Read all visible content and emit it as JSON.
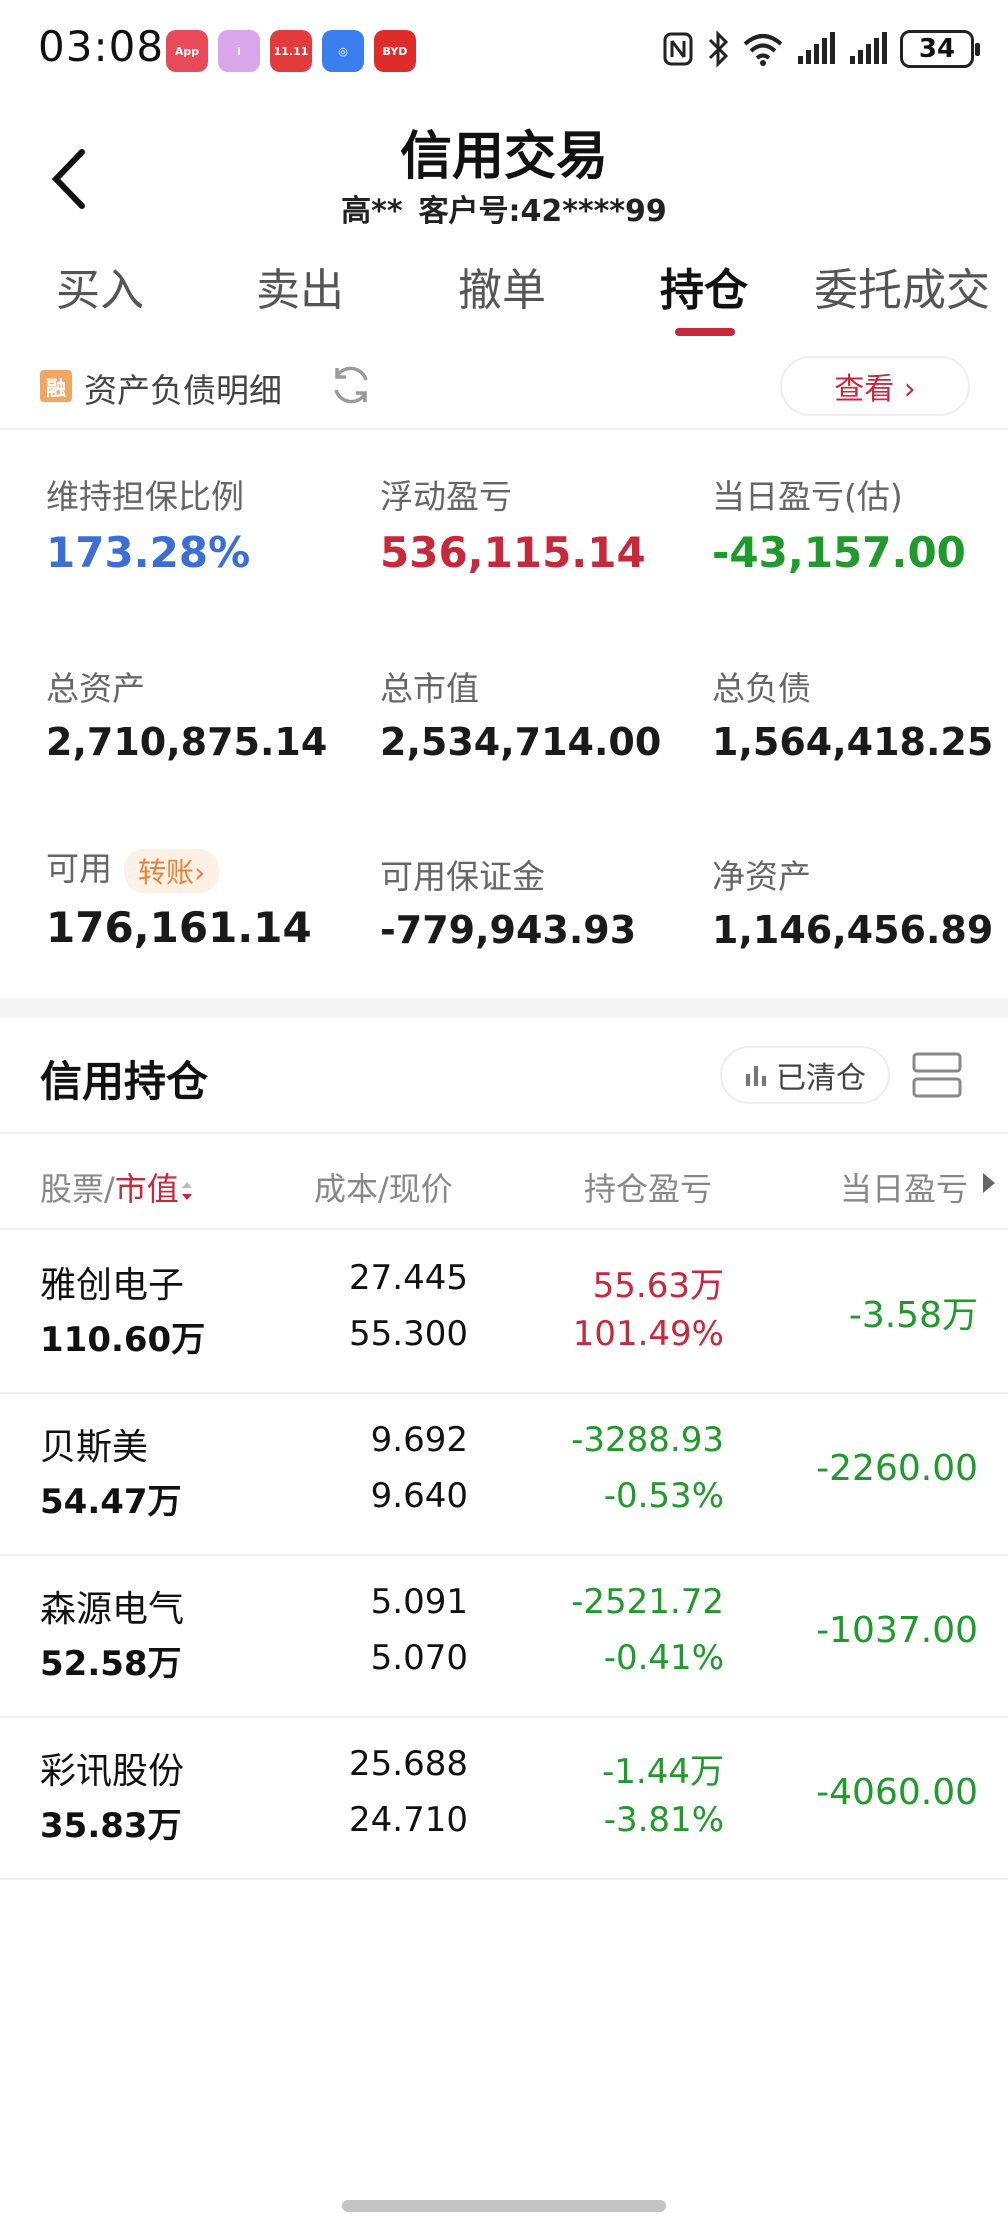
{
  "status": {
    "time": "03:08",
    "battery": "34",
    "app_icons": [
      {
        "name": "app-gallery-icon",
        "color": "#e84a5a",
        "text": "App"
      },
      {
        "name": "app-i-icon",
        "color": "#d8a0e8",
        "text": "i"
      },
      {
        "name": "app-1111-icon",
        "color": "#e33b3b",
        "text": "11.11"
      },
      {
        "name": "app-shield-icon",
        "color": "#3b7ef0",
        "text": "◎"
      },
      {
        "name": "app-byd-icon",
        "color": "#e02b2b",
        "text": "BYD"
      }
    ]
  },
  "header": {
    "title": "信用交易",
    "user_name": "高**",
    "account": "客户号:42****99"
  },
  "tabs": [
    "买入",
    "卖出",
    "撤单",
    "持仓",
    "委托成交"
  ],
  "active_tab": "持仓",
  "asset_bar": {
    "badge": "融",
    "label": "资产负债明细",
    "view_button": "查看 ›"
  },
  "summary": {
    "maintain_ratio": {
      "label": "维持担保比例",
      "value": "173.28%"
    },
    "floating_pl": {
      "label": "浮动盈亏",
      "value": "536,115.14"
    },
    "day_pl": {
      "label": "当日盈亏(估)",
      "value": "-43,157.00"
    },
    "total_assets": {
      "label": "总资产",
      "value": "2,710,875.14"
    },
    "total_mv": {
      "label": "总市值",
      "value": "2,534,714.00"
    },
    "total_debt": {
      "label": "总负债",
      "value": "1,564,418.25"
    },
    "available": {
      "label": "可用",
      "value": "176,161.14",
      "transfer": "转账›"
    },
    "avail_margin": {
      "label": "可用保证金",
      "value": "-779,943.93"
    },
    "net_assets": {
      "label": "净资产",
      "value": "1,146,456.89"
    }
  },
  "holdings": {
    "title": "信用持仓",
    "cleared_button": "已清仓",
    "columns": {
      "stock": "股票/",
      "mv": "市值",
      "cost": "成本/现价",
      "pl": "持仓盈亏",
      "day": "当日盈亏"
    },
    "rows": [
      {
        "name": "雅创电子",
        "mv": "110.60万",
        "cost": "27.445",
        "price": "55.300",
        "pl": "55.63万",
        "pl_pct": "101.49%",
        "day": "-3.58万",
        "pl_color": "red"
      },
      {
        "name": "贝斯美",
        "mv": "54.47万",
        "cost": "9.692",
        "price": "9.640",
        "pl": "-3288.93",
        "pl_pct": "-0.53%",
        "day": "-2260.00",
        "pl_color": "green"
      },
      {
        "name": "森源电气",
        "mv": "52.58万",
        "cost": "5.091",
        "price": "5.070",
        "pl": "-2521.72",
        "pl_pct": "-0.41%",
        "day": "-1037.00",
        "pl_color": "green"
      },
      {
        "name": "彩讯股份",
        "mv": "35.83万",
        "cost": "25.688",
        "price": "24.710",
        "pl": "-1.44万",
        "pl_pct": "-3.81%",
        "day": "-4060.00",
        "pl_color": "green"
      }
    ]
  }
}
